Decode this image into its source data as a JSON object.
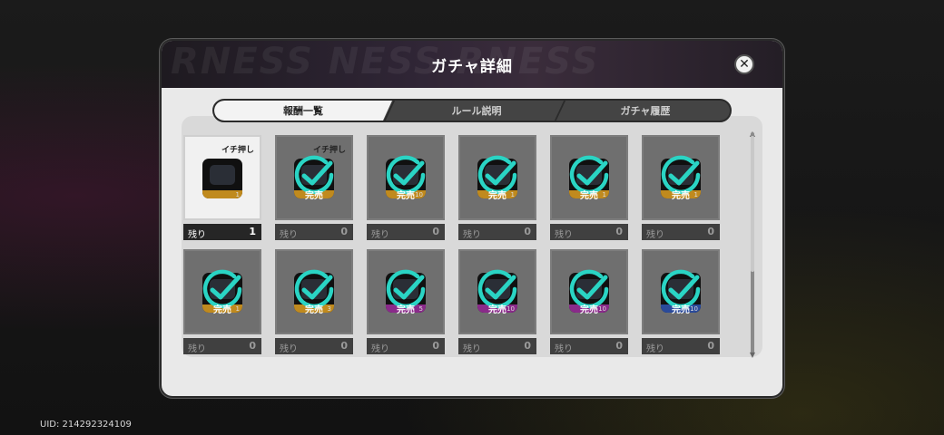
{
  "uid_text": "UID: 214292324109",
  "dialog": {
    "title": "ガチャ詳細",
    "close_label": "✕",
    "header_deco": "RNESS NESS RNESS"
  },
  "tabs": [
    {
      "label": "報酬一覧",
      "active": true
    },
    {
      "label": "ルール説明",
      "active": false
    },
    {
      "label": "ガチャ履歴",
      "active": false
    }
  ],
  "cards": [
    {
      "tag": "イチ押し",
      "remaining_label": "残り",
      "remaining": "1",
      "sold_out": false,
      "qty": "1",
      "strip_color": "#c08a1e"
    },
    {
      "tag": "イチ押し",
      "remaining_label": "残り",
      "remaining": "0",
      "sold_out": true,
      "sold_label": "完売",
      "qty": "",
      "strip_color": "#c08a1e"
    },
    {
      "tag": "",
      "remaining_label": "残り",
      "remaining": "0",
      "sold_out": true,
      "sold_label": "完売",
      "qty": "10",
      "strip_color": "#c08a1e"
    },
    {
      "tag": "",
      "remaining_label": "残り",
      "remaining": "0",
      "sold_out": true,
      "sold_label": "完売",
      "qty": "1",
      "strip_color": "#c08a1e"
    },
    {
      "tag": "",
      "remaining_label": "残り",
      "remaining": "0",
      "sold_out": true,
      "sold_label": "完売",
      "qty": "1",
      "strip_color": "#c08a1e"
    },
    {
      "tag": "",
      "remaining_label": "残り",
      "remaining": "0",
      "sold_out": true,
      "sold_label": "完売",
      "qty": "1",
      "strip_color": "#c08a1e"
    },
    {
      "tag": "",
      "remaining_label": "残り",
      "remaining": "0",
      "sold_out": true,
      "sold_label": "完売",
      "qty": "1",
      "strip_color": "#c08a1e"
    },
    {
      "tag": "",
      "remaining_label": "残り",
      "remaining": "0",
      "sold_out": true,
      "sold_label": "完売",
      "qty": "3",
      "strip_color": "#c08a1e"
    },
    {
      "tag": "",
      "remaining_label": "残り",
      "remaining": "0",
      "sold_out": true,
      "sold_label": "完売",
      "qty": "5",
      "strip_color": "#8a2a8a"
    },
    {
      "tag": "",
      "remaining_label": "残り",
      "remaining": "0",
      "sold_out": true,
      "sold_label": "完売",
      "qty": "10",
      "strip_color": "#8a2a8a"
    },
    {
      "tag": "",
      "remaining_label": "残り",
      "remaining": "0",
      "sold_out": true,
      "sold_label": "完売",
      "qty": "10",
      "strip_color": "#8a2a8a"
    },
    {
      "tag": "",
      "remaining_label": "残り",
      "remaining": "0",
      "sold_out": true,
      "sold_label": "完売",
      "qty": "10",
      "strip_color": "#2a4a9a"
    }
  ],
  "colors": {
    "check_teal": "#2ad4c4",
    "dialog_bg": "#e9e9e9",
    "header_bg": "#2f2535"
  }
}
